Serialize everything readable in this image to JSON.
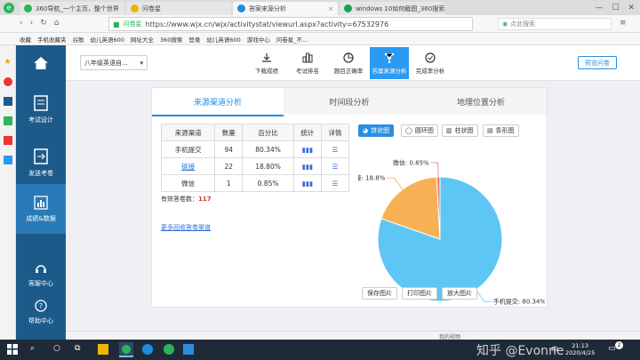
{
  "browser": {
    "tabs": [
      {
        "label": "360导航_一个主页，整个世界",
        "color": "#2db45a"
      },
      {
        "label": "问卷星",
        "color": "#f0b400"
      },
      {
        "label": "答案来源分析",
        "color": "#1c8fe0",
        "active": true
      },
      {
        "label": "windows 10如何截图_360搜索",
        "color": "#1ca05a"
      }
    ],
    "url_site": "问卷星",
    "url": "https://www.wjx.cn/wjx/activitystat/viewurl.aspx?activity=67532976",
    "search_placeholder": "点此搜索",
    "bookmarks": [
      "收藏",
      "手机收藏夹",
      "谷歌",
      "幼儿英语600",
      "网址大全",
      "360搜索",
      "登录",
      "幼儿英语600",
      "游戏中心",
      "问卷星_不..."
    ]
  },
  "left_nav": [
    {
      "label": "考试设计"
    },
    {
      "label": "发送考卷"
    },
    {
      "label": "成绩&数据",
      "active": true
    },
    {
      "label": "客服中心"
    },
    {
      "label": "帮助中心"
    }
  ],
  "topbar": {
    "survey_select": "八年级英语自...",
    "tools": [
      {
        "label": "下载成绩"
      },
      {
        "label": "考试排名"
      },
      {
        "label": "题目正确率"
      },
      {
        "label": "答案来源分析",
        "active": true
      },
      {
        "label": "完成率分析"
      }
    ],
    "preview_btn": "预览问卷"
  },
  "sub_tabs": [
    "来源渠道分析",
    "时间段分析",
    "地理位置分析"
  ],
  "table": {
    "headers": [
      "来源渠道",
      "数量",
      "百分比",
      "统计",
      "详情"
    ],
    "rows": [
      {
        "channel": "手机提交",
        "count": "94",
        "pct": "80.34%"
      },
      {
        "channel": "链接",
        "count": "22",
        "pct": "18.80%"
      },
      {
        "channel": "微信",
        "count": "1",
        "pct": "0.85%"
      }
    ],
    "valid_label": "有效答卷数：",
    "valid_count": "117",
    "more_link": "更多回收答卷渠道"
  },
  "chart_types": [
    "饼状图",
    "圆环图",
    "柱状图",
    "条形图"
  ],
  "chart_data": {
    "type": "pie",
    "labels": [
      "手机提交",
      "链接",
      "微信"
    ],
    "values": [
      80.34,
      18.8,
      0.85
    ],
    "data_labels": [
      "手机提交: 80.34%",
      "链接: 18.8%",
      "微信: 0.85%"
    ],
    "colors": [
      "#5ec6f5",
      "#f7b154",
      "#e8747c"
    ]
  },
  "chart_buttons": [
    "保存图片",
    "打印图片",
    "放大图片"
  ],
  "status": {
    "video": "我的视频"
  },
  "taskbar": {
    "time": "21:13",
    "date": "2020/4/25",
    "lang": "中",
    "badge": "2",
    "watermark": "知乎 @Evonne"
  }
}
